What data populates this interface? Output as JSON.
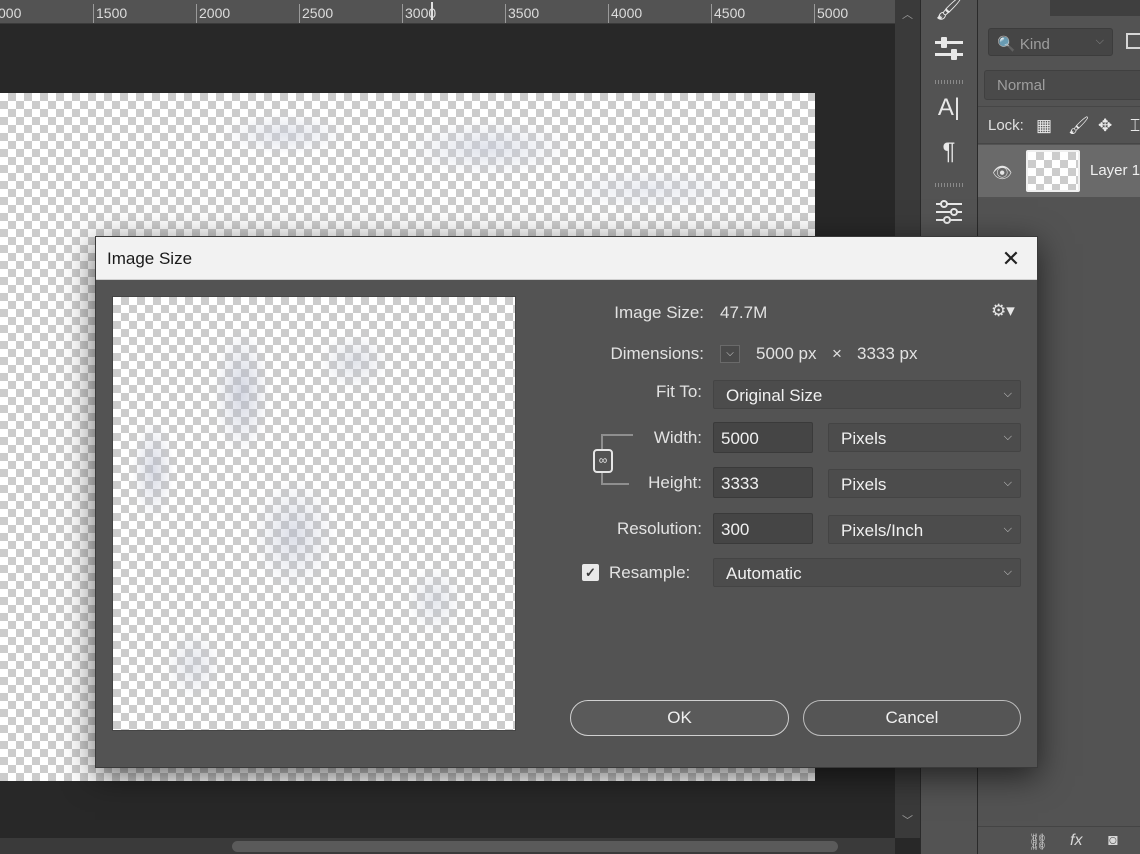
{
  "ruler": {
    "labels": [
      "000",
      "1500",
      "2000",
      "2500",
      "3000",
      "3500",
      "4000",
      "4500",
      "5000"
    ]
  },
  "tools": {
    "icons": [
      "brush-icon",
      "adjust-icon",
      "character-icon",
      "paragraph-icon",
      "properties-icon"
    ]
  },
  "layers_panel": {
    "kind_filter": "Kind",
    "blend_mode": "Normal",
    "lock_label": "Lock:",
    "layer_name": "Layer 1"
  },
  "dialog": {
    "title": "Image Size",
    "image_size_label": "Image Size:",
    "image_size_value": "47.7M",
    "dimensions_label": "Dimensions:",
    "dimensions_width": "5000 px",
    "dimensions_times": "×",
    "dimensions_height": "3333 px",
    "fit_to_label": "Fit To:",
    "fit_to_value": "Original Size",
    "width_label": "Width:",
    "width_value": "5000",
    "width_unit": "Pixels",
    "height_label": "Height:",
    "height_value": "3333",
    "height_unit": "Pixels",
    "resolution_label": "Resolution:",
    "resolution_value": "300",
    "resolution_unit": "Pixels/Inch",
    "resample_label": "Resample:",
    "resample_checked": true,
    "resample_value": "Automatic",
    "ok_label": "OK",
    "cancel_label": "Cancel"
  }
}
